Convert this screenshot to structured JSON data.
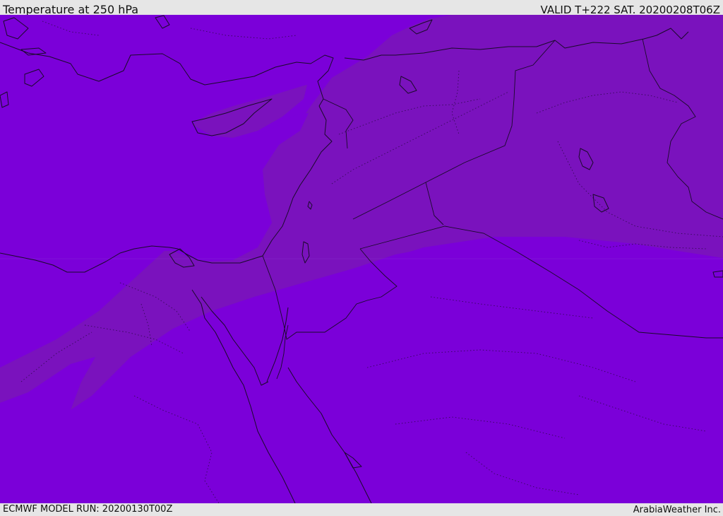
{
  "header": {
    "title": "Temperature at 250 hPa",
    "valid": "VALID T+222 SAT. 20200208T06Z"
  },
  "footer": {
    "model_run": "ECMWF MODEL RUN: 20200130T00Z",
    "credit": "ArabiaWeather Inc."
  },
  "map": {
    "background_color": "#7b00d9",
    "warm_band_color": "#7a12bd",
    "coastline_color": "#1a0a2a"
  }
}
